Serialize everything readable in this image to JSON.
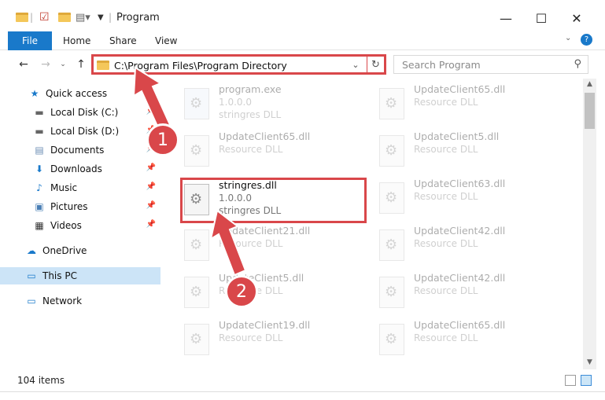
{
  "window": {
    "title": "Program",
    "minimize_icon": "minimize-icon",
    "maximize_icon": "maximize-icon",
    "close_icon": "close-icon"
  },
  "ribbon": {
    "file_label": "File",
    "tabs": [
      "Home",
      "Share",
      "View"
    ]
  },
  "address": {
    "path": "C:\\Program Files\\Program Directory"
  },
  "search": {
    "placeholder": "Search Program"
  },
  "sidebar": {
    "items": [
      {
        "label": "Quick access",
        "icon": "star-icon"
      },
      {
        "label": "Local Disk (C:)",
        "icon": "drive-icon"
      },
      {
        "label": "Local Disk (D:)",
        "icon": "drive-icon"
      },
      {
        "label": "Documents",
        "icon": "documents-icon"
      },
      {
        "label": "Downloads",
        "icon": "downloads-icon"
      },
      {
        "label": "Music",
        "icon": "music-icon"
      },
      {
        "label": "Pictures",
        "icon": "pictures-icon"
      },
      {
        "label": "Videos",
        "icon": "videos-icon"
      },
      {
        "label": "OneDrive",
        "icon": "cloud-icon"
      },
      {
        "label": "This PC",
        "icon": "computer-icon"
      },
      {
        "label": "Network",
        "icon": "network-icon"
      }
    ]
  },
  "files": [
    {
      "name": "program.exe",
      "line1": "1.0.0.0",
      "line2": "stringres DLL"
    },
    {
      "name": "UpdateClient65.dll",
      "line1": "Resource DLL",
      "line2": ""
    },
    {
      "name": "UpdateClient65.dll",
      "line1": "Resource DLL",
      "line2": ""
    },
    {
      "name": "UpdateClient5.dll",
      "line1": "Resource DLL",
      "line2": ""
    },
    {
      "name": "stringres.dll",
      "line1": "1.0.0.0",
      "line2": "stringres DLL"
    },
    {
      "name": "UpdateClient63.dll",
      "line1": "Resource DLL",
      "line2": ""
    },
    {
      "name": "UpdateClient21.dll",
      "line1": "Resource DLL",
      "line2": ""
    },
    {
      "name": "UpdateClient42.dll",
      "line1": "Resource DLL",
      "line2": ""
    },
    {
      "name": "UpdateClient5.dll",
      "line1": "Resource DLL",
      "line2": ""
    },
    {
      "name": "UpdateClient42.dll",
      "line1": "Resource DLL",
      "line2": ""
    },
    {
      "name": "UpdateClient19.dll",
      "line1": "Resource DLL",
      "line2": ""
    },
    {
      "name": "UpdateClient65.dll",
      "line1": "Resource DLL",
      "line2": ""
    }
  ],
  "status": {
    "count": "104 items"
  },
  "annotations": {
    "step1": "1",
    "step2": "2"
  },
  "colors": {
    "accent": "#1979ca",
    "highlight": "#d9474a",
    "selected": "#cce4f7"
  }
}
